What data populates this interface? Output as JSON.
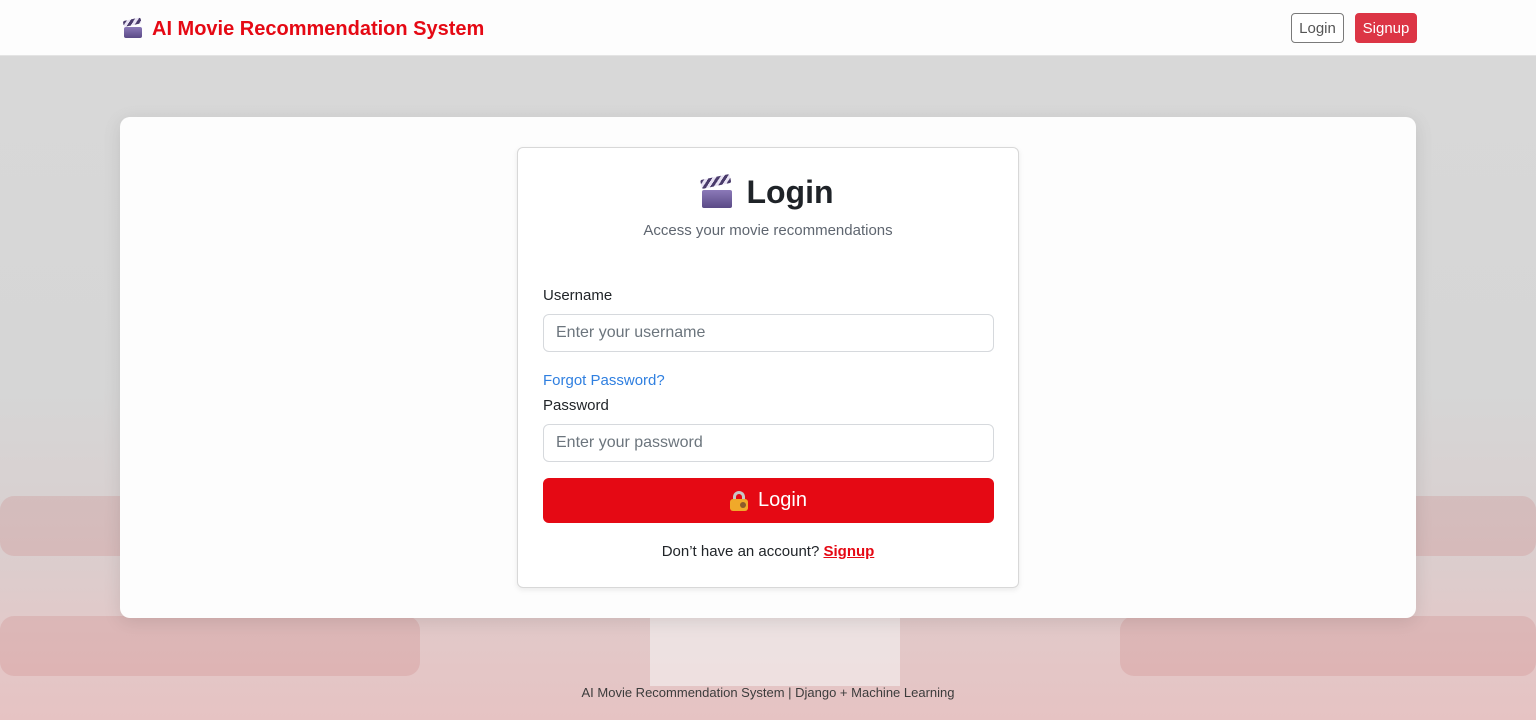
{
  "navbar": {
    "brand": "AI Movie Recommendation System",
    "brand_icon": "clapper-board-icon",
    "login_label": "Login",
    "signup_label": "Signup"
  },
  "login_form": {
    "title_icon": "clapper-board-icon",
    "title": "Login",
    "subtitle": "Access your movie recommendations",
    "username_label": "Username",
    "username_placeholder": "Enter your username",
    "forgot_password": "Forgot Password?",
    "password_label": "Password",
    "password_placeholder": "Enter your password",
    "submit_icon": "locked-with-key-icon",
    "submit_label": "Login",
    "no_account_text": "Don’t have an account?",
    "signup_link": "Signup"
  },
  "footer": {
    "text": "AI Movie Recommendation System | Django + Machine Learning"
  },
  "colors": {
    "brand_red": "#e50914",
    "signup_button": "#dc3545",
    "link_blue": "#2f7fe0"
  }
}
